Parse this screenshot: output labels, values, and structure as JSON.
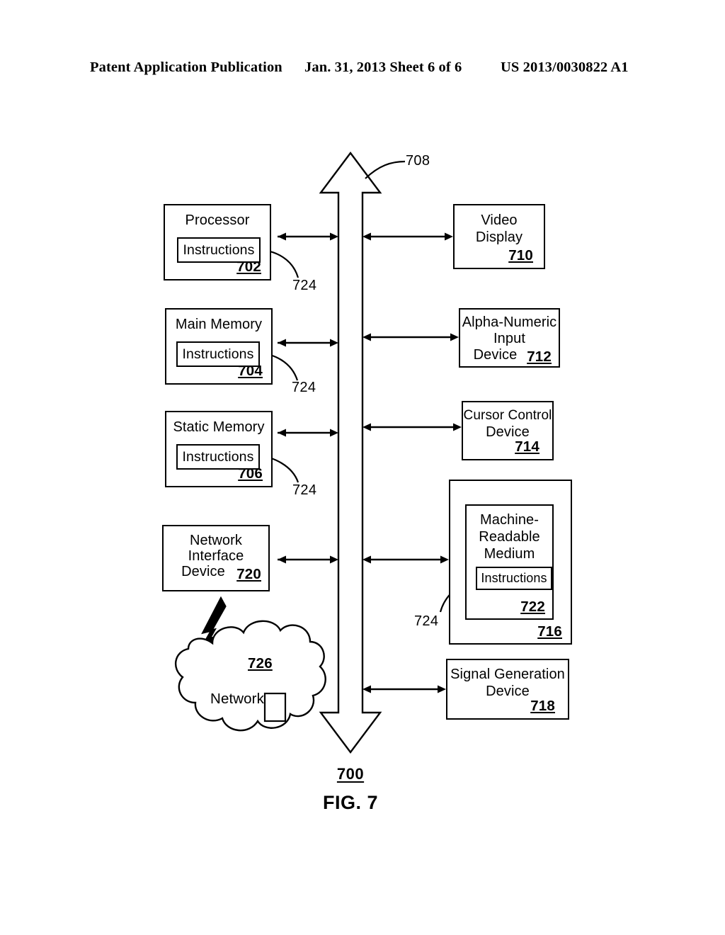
{
  "header": {
    "left": "Patent Application Publication",
    "middle": "Jan. 31, 2013  Sheet 6 of 6",
    "right": "US 2013/0030822 A1"
  },
  "figure": {
    "caption": "FIG. 7",
    "system_ref": "700",
    "bus_ref": "708",
    "left_column": [
      {
        "name": "processor",
        "title": "Processor",
        "ref": "702",
        "inner_label": "Instructions",
        "leader_ref": "724"
      },
      {
        "name": "main-memory",
        "title": "Main Memory",
        "ref": "704",
        "inner_label": "Instructions",
        "leader_ref": "724"
      },
      {
        "name": "static-memory",
        "title": "Static Memory",
        "ref": "706",
        "inner_label": "Instructions",
        "leader_ref": "724"
      },
      {
        "name": "network-interface-device",
        "title_line1": "Network",
        "title_line2": "Interface",
        "title_line3": "Device",
        "ref": "720"
      }
    ],
    "network_cloud": {
      "label": "Network",
      "ref": "726"
    },
    "right_column": [
      {
        "name": "video-display",
        "title_line1": "Video",
        "title_line2": "Display",
        "ref": "710"
      },
      {
        "name": "alpha-numeric-input-device",
        "title_line1": "Alpha-Numeric",
        "title_line2": "Input",
        "title_line3": "Device",
        "ref": "712"
      },
      {
        "name": "cursor-control-device",
        "title_line1": "Cursor Control",
        "title_line2": "Device",
        "ref": "714"
      },
      {
        "name": "data-storage-device",
        "ref": "716",
        "medium": {
          "title_line1": "Machine-",
          "title_line2": "Readable",
          "title_line3": "Medium",
          "ref": "722",
          "inner_label": "Instructions",
          "leader_ref": "724"
        }
      },
      {
        "name": "signal-generation-device",
        "title_line1": "Signal Generation",
        "title_line2": "Device",
        "ref": "718"
      }
    ]
  }
}
